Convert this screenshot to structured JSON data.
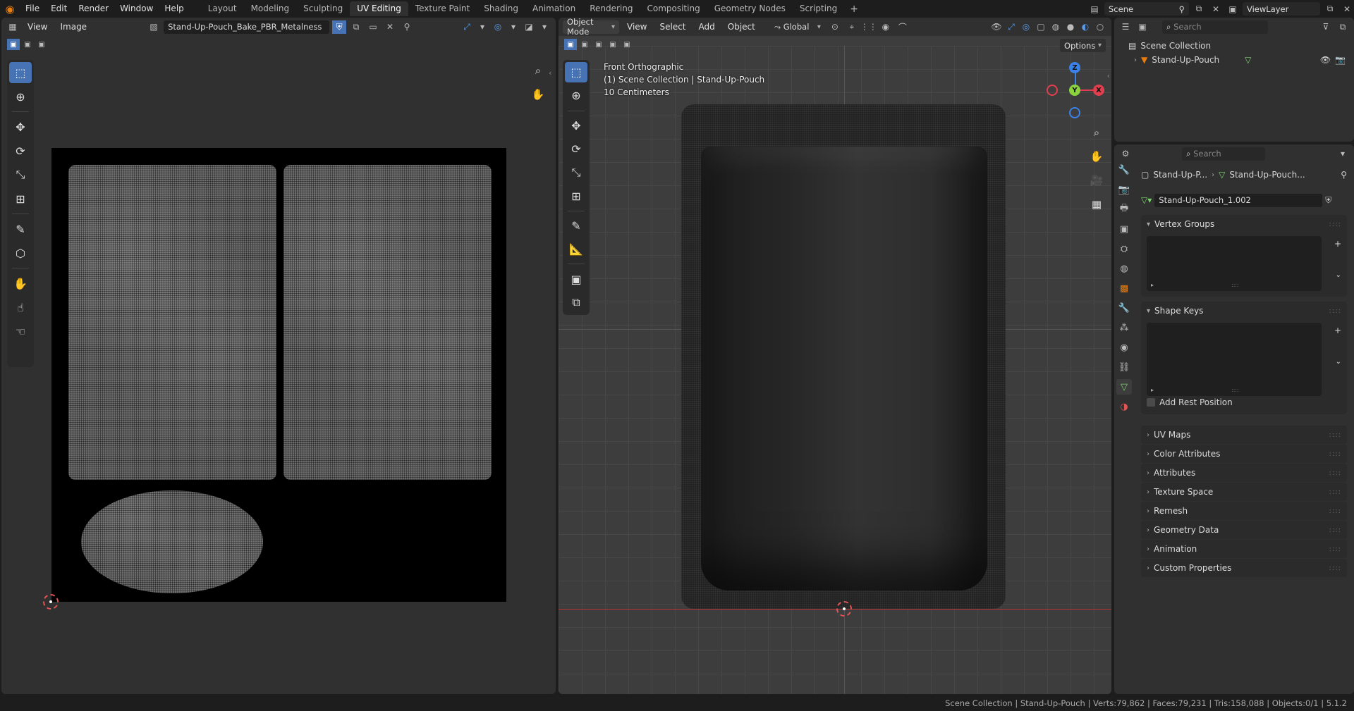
{
  "menu": {
    "file": "File",
    "edit": "Edit",
    "render": "Render",
    "window": "Window",
    "help": "Help"
  },
  "workspaces": [
    "Layout",
    "Modeling",
    "Sculpting",
    "UV Editing",
    "Texture Paint",
    "Shading",
    "Animation",
    "Rendering",
    "Compositing",
    "Geometry Nodes",
    "Scripting"
  ],
  "active_workspace": "UV Editing",
  "scene": {
    "name": "Scene",
    "view_layer": "ViewLayer"
  },
  "uv_editor": {
    "menus": {
      "view": "View",
      "image": "Image"
    },
    "image_name": "Stand-Up-Pouch_Bake_PBR_Metalness"
  },
  "viewport": {
    "mode": "Object Mode",
    "menus": {
      "view": "View",
      "select": "Select",
      "add": "Add",
      "object": "Object"
    },
    "orientation": "Global",
    "options": "Options",
    "info": {
      "view": "Front Orthographic",
      "collection": "(1) Scene Collection | Stand-Up-Pouch",
      "scale": "10 Centimeters"
    },
    "gizmo": {
      "z": "Z",
      "y": "Y",
      "x": "X"
    }
  },
  "outliner": {
    "search_placeholder": "Search",
    "collection": "Scene Collection",
    "object": "Stand-Up-Pouch"
  },
  "properties": {
    "search_placeholder": "Search",
    "breadcrumb_object": "Stand-Up-P...",
    "breadcrumb_mesh": "Stand-Up-Pouch...",
    "mesh_name": "Stand-Up-Pouch_1.002",
    "vertex_groups": "Vertex Groups",
    "shape_keys": "Shape Keys",
    "add_rest_position": "Add Rest Position",
    "sections": [
      "UV Maps",
      "Color Attributes",
      "Attributes",
      "Texture Space",
      "Remesh",
      "Geometry Data",
      "Animation",
      "Custom Properties"
    ]
  },
  "status": "Scene Collection | Stand-Up-Pouch | Verts:79,862 | Faces:79,231 | Tris:158,088 | Objects:0/1 | 5.1.2"
}
